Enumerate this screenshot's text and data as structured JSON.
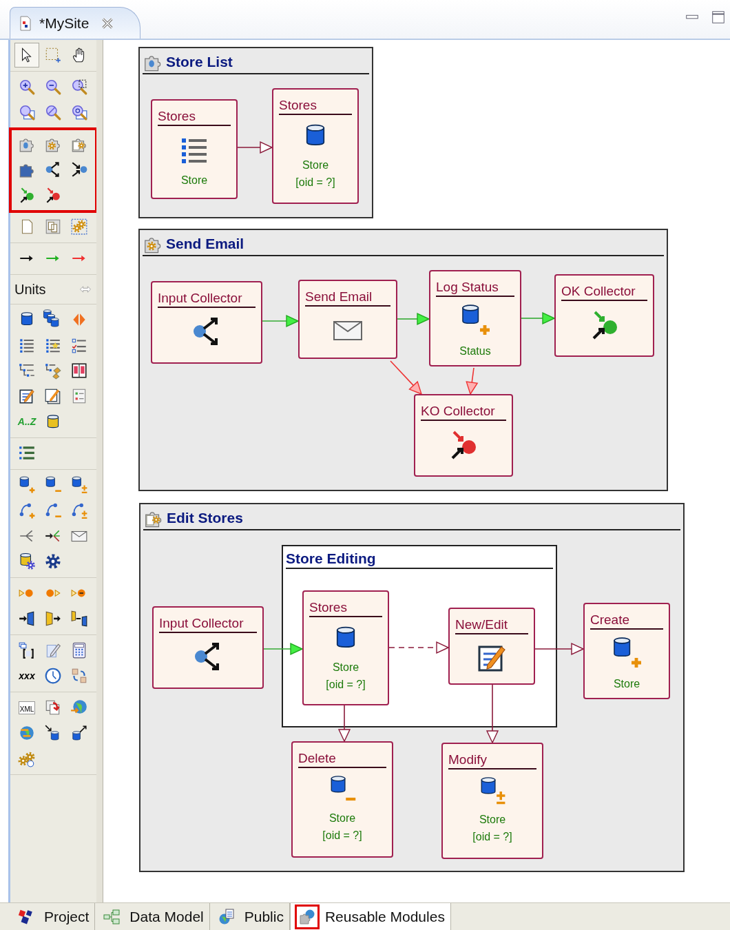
{
  "editor_tab": {
    "title": "*MySite"
  },
  "palette": {
    "sections": [
      {
        "highlighted": false,
        "tools": [
          {
            "selected": true
          },
          {
            "selected": false
          },
          {
            "selected": false
          }
        ]
      },
      {
        "highlighted": false,
        "tools": [
          {
            "selected": false
          },
          {
            "selected": false
          },
          {
            "selected": false
          },
          {
            "selected": false
          },
          {
            "selected": false
          },
          {
            "selected": false
          }
        ]
      },
      {
        "highlighted": true,
        "tools": [
          {
            "selected": false
          },
          {
            "selected": false
          },
          {
            "selected": false
          },
          {
            "selected": false
          },
          {
            "selected": false
          },
          {
            "selected": false
          },
          {
            "selected": false
          },
          {
            "selected": false
          }
        ]
      },
      {
        "highlighted": false,
        "tools": [
          {
            "selected": false
          },
          {
            "selected": false
          },
          {
            "selected": false
          }
        ]
      },
      {
        "highlighted": false,
        "tools": [
          {
            "selected": false
          },
          {
            "selected": false
          },
          {
            "selected": false
          }
        ]
      }
    ],
    "drawer": {
      "label": "Units",
      "sections": [
        {
          "tools": [
            {
              "selected": false
            },
            {
              "selected": false
            },
            {
              "selected": false
            },
            {
              "selected": false
            },
            {
              "selected": false
            },
            {
              "selected": false
            },
            {
              "selected": false
            },
            {
              "selected": false
            },
            {
              "selected": false
            },
            {
              "selected": false
            },
            {
              "selected": false
            },
            {
              "selected": false
            },
            {
              "selected": false,
              "label": "A..Z"
            },
            {
              "selected": false
            }
          ]
        },
        {
          "tools": [
            {
              "selected": false
            }
          ]
        },
        {
          "tools": [
            {
              "selected": false
            },
            {
              "selected": false
            },
            {
              "selected": false
            },
            {
              "selected": false
            },
            {
              "selected": false
            },
            {
              "selected": false
            },
            {
              "selected": false
            },
            {
              "selected": false
            },
            {
              "selected": false
            },
            {
              "selected": false
            },
            {
              "selected": false
            }
          ]
        },
        {
          "tools": [
            {
              "selected": false
            },
            {
              "selected": false
            },
            {
              "selected": false
            },
            {
              "selected": false
            },
            {
              "selected": false
            },
            {
              "selected": false
            }
          ]
        },
        {
          "tools": [
            {
              "selected": false
            },
            {
              "selected": false
            },
            {
              "selected": false
            },
            {
              "selected": false,
              "label": "xxx"
            },
            {
              "selected": false
            },
            {
              "selected": false
            }
          ]
        },
        {
          "tools": [
            {
              "selected": false,
              "label": "XML"
            },
            {
              "selected": false
            },
            {
              "selected": false
            },
            {
              "selected": false
            },
            {
              "selected": false
            },
            {
              "selected": false
            },
            {
              "selected": false
            }
          ]
        }
      ]
    }
  },
  "modules": [
    {
      "title": "Store List",
      "nodes": [
        {
          "kind": "index",
          "title": "Stores",
          "lines": [
            "Store"
          ]
        },
        {
          "kind": "data",
          "title": "Stores",
          "lines": [
            "Store",
            "[oid = ?]"
          ]
        }
      ],
      "links": [
        {
          "kind": "normal"
        }
      ]
    },
    {
      "title": "Send Email",
      "nodes": [
        {
          "kind": "input-collector",
          "title": "Input Collector"
        },
        {
          "kind": "send-mail",
          "title": "Send Email"
        },
        {
          "kind": "create",
          "title": "Log Status",
          "lines": [
            "Status"
          ]
        },
        {
          "kind": "ok-collector",
          "title": "OK Collector"
        },
        {
          "kind": "ko-collector",
          "title": "KO Collector"
        }
      ],
      "links": [
        {
          "kind": "ok"
        },
        {
          "kind": "ok"
        },
        {
          "kind": "ok"
        },
        {
          "kind": "ko"
        },
        {
          "kind": "ko"
        }
      ]
    },
    {
      "title": "Edit Stores",
      "group": {
        "title": "Store Editing"
      },
      "nodes": [
        {
          "kind": "input-collector",
          "title": "Input Collector"
        },
        {
          "kind": "data",
          "title": "Stores",
          "lines": [
            "Store",
            "[oid = ?]"
          ]
        },
        {
          "kind": "entry",
          "title": "New/Edit"
        },
        {
          "kind": "create",
          "title": "Create",
          "lines": [
            "Store"
          ]
        },
        {
          "kind": "delete",
          "title": "Delete",
          "lines": [
            "Store",
            "[oid = ?]"
          ]
        },
        {
          "kind": "modify",
          "title": "Modify",
          "lines": [
            "Store",
            "[oid = ?]"
          ]
        }
      ],
      "links": [
        {
          "kind": "ok"
        },
        {
          "kind": "transport"
        },
        {
          "kind": "normal"
        },
        {
          "kind": "normal"
        },
        {
          "kind": "normal"
        }
      ]
    }
  ],
  "bottom_tabs": [
    {
      "label": "Project",
      "selected": false,
      "highlighted": false
    },
    {
      "label": "Data Model",
      "selected": false,
      "highlighted": false
    },
    {
      "label": "Public",
      "selected": false,
      "highlighted": false
    },
    {
      "label": "Reusable Modules",
      "selected": true,
      "highlighted": true
    }
  ]
}
